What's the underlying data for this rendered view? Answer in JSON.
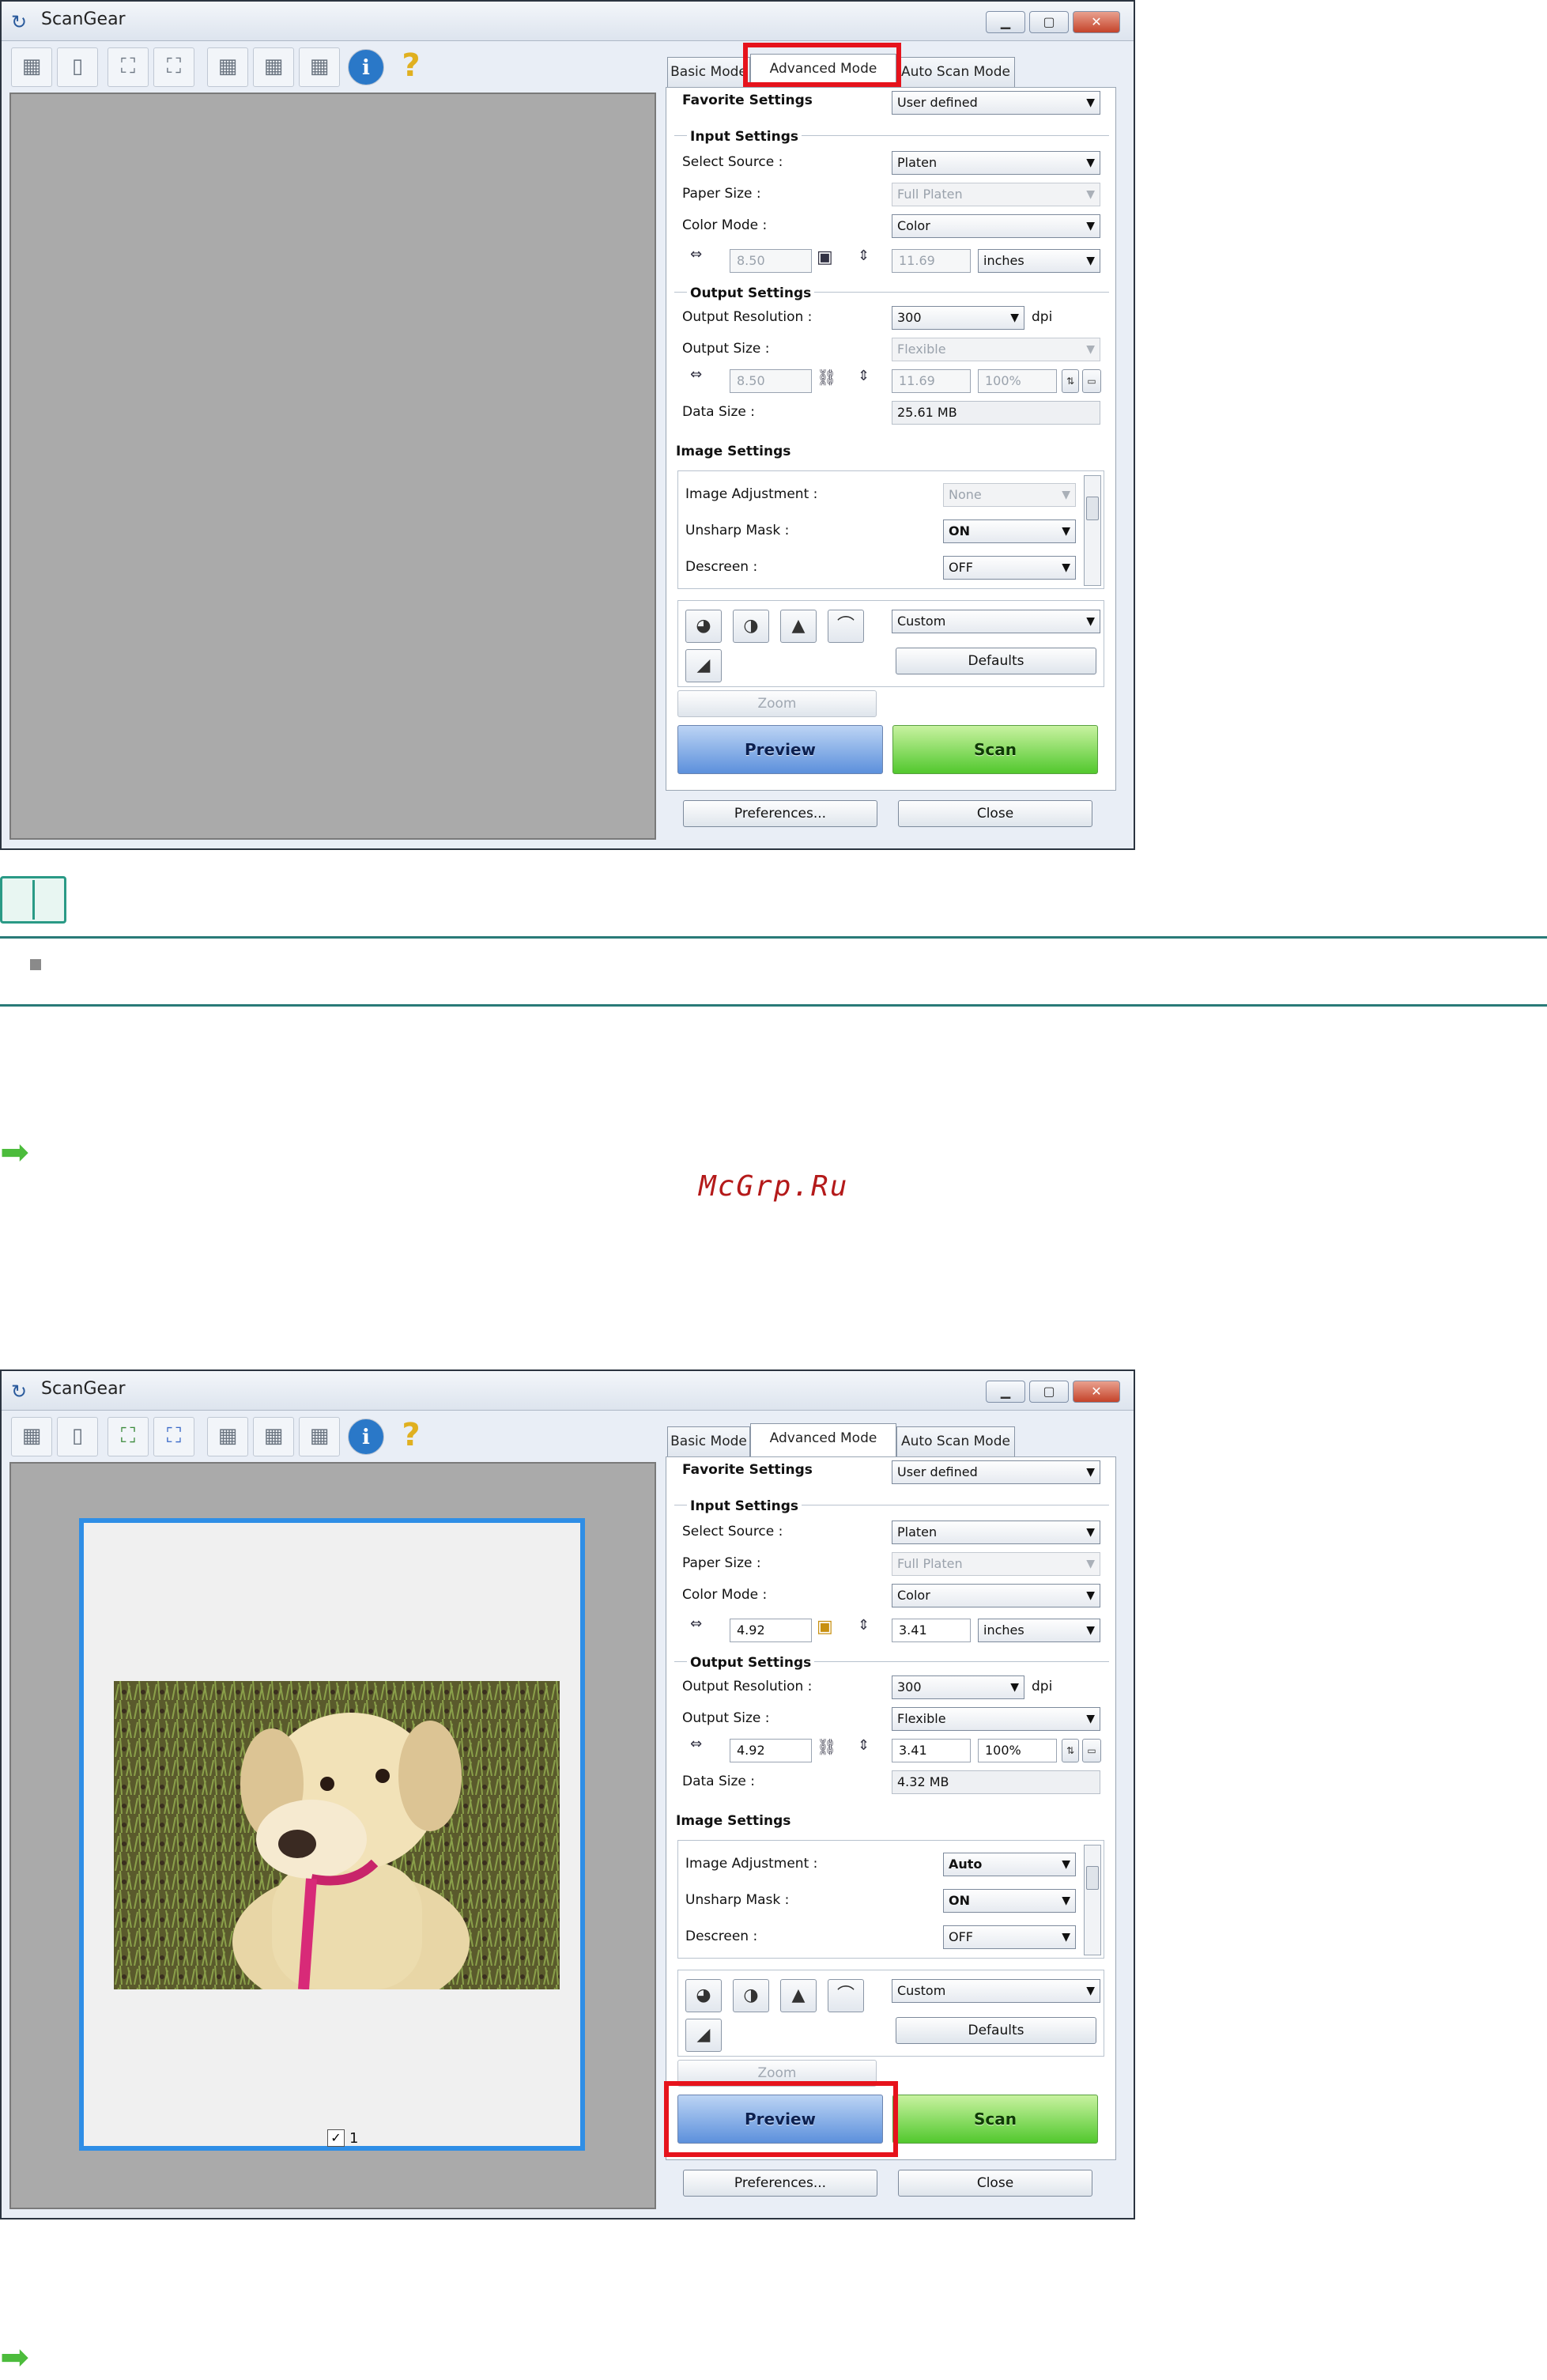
{
  "app_title": "ScanGear",
  "toolbar_icons": [
    "scanner-icon",
    "blank-page-icon",
    "crop-frame-icon",
    "auto-crop-icon",
    "grid-1-icon",
    "grid-2-icon",
    "grid-3-icon",
    "info-icon",
    "help-icon"
  ],
  "tabs": {
    "basic": "Basic Mode",
    "advanced": "Advanced Mode",
    "auto": "Auto Scan Mode"
  },
  "favorite": {
    "label": "Favorite Settings",
    "value": "User defined"
  },
  "input": {
    "title": "Input Settings",
    "select_source_label": "Select Source :",
    "select_source": "Platen",
    "paper_size_label": "Paper Size :",
    "paper_size": "Full Platen",
    "color_mode_label": "Color Mode :",
    "color_mode": "Color",
    "units": "inches"
  },
  "output": {
    "title": "Output Settings",
    "resolution_label": "Output Resolution :",
    "resolution": "300",
    "dpi": "dpi",
    "size_label": "Output Size :",
    "size": "Flexible",
    "scale": "100%",
    "data_size_label": "Data Size :"
  },
  "image": {
    "title": "Image Settings",
    "adjust_label": "Image Adjustment :",
    "unsharp_label": "Unsharp Mask :",
    "unsharp": "ON",
    "descreen_label": "Descreen :",
    "descreen": "OFF",
    "tone": "Custom",
    "defaults": "Defaults"
  },
  "buttons": {
    "zoom": "Zoom",
    "preview": "Preview",
    "scan": "Scan",
    "preferences": "Preferences...",
    "close": "Close"
  },
  "screen1": {
    "width": "8.50",
    "height": "11.69",
    "out_width": "8.50",
    "out_height": "11.69",
    "data_size": "25.61 MB",
    "adjust": "None",
    "output_size": "Flexible"
  },
  "screen2": {
    "width": "4.92",
    "height": "3.41",
    "out_width": "4.92",
    "out_height": "3.41",
    "data_size": "4.32 MB",
    "adjust": "Auto",
    "thumb_number": "1"
  },
  "watermark": "McGrp.Ru"
}
